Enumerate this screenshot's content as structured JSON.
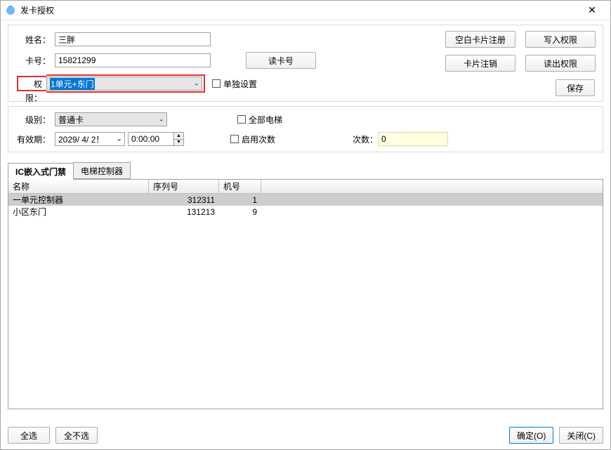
{
  "window": {
    "title": "发卡授权"
  },
  "form": {
    "name_label": "姓名：",
    "name_value": "三胖",
    "card_label": "卡号：",
    "card_value": "15821299",
    "read_card_btn": "读卡号",
    "perm_label": "权限：",
    "perm_value": "1单元+东门",
    "single_set": "单独设置"
  },
  "actions": {
    "blank_register": "空白卡片注册",
    "write_perm": "写入权限",
    "card_cancel": "卡片注销",
    "read_perm": "读出权限",
    "save": "保存"
  },
  "options": {
    "level_label": "级别：",
    "level_value": "普通卡",
    "validity_label": "有效期：",
    "date_value": "2029/ 4/ 2！",
    "time_value": "0:00:00",
    "all_elevators": "全部电梯",
    "enable_count": "启用次数",
    "count_label": "次数：",
    "count_value": "0"
  },
  "tabs": {
    "t1": "IC嵌入式门禁",
    "t2": "电梯控制器"
  },
  "table": {
    "headers": {
      "name": "名称",
      "sn": "序列号",
      "no": "机号"
    },
    "rows": [
      {
        "name": "一单元控制器",
        "sn": "312311",
        "no": "1",
        "selected": true
      },
      {
        "name": "小区东门",
        "sn": "131213",
        "no": "9",
        "selected": false
      }
    ]
  },
  "footer": {
    "select_all": "全选",
    "select_none": "全不选",
    "ok": "确定(O)",
    "close": "关闭(C)"
  }
}
